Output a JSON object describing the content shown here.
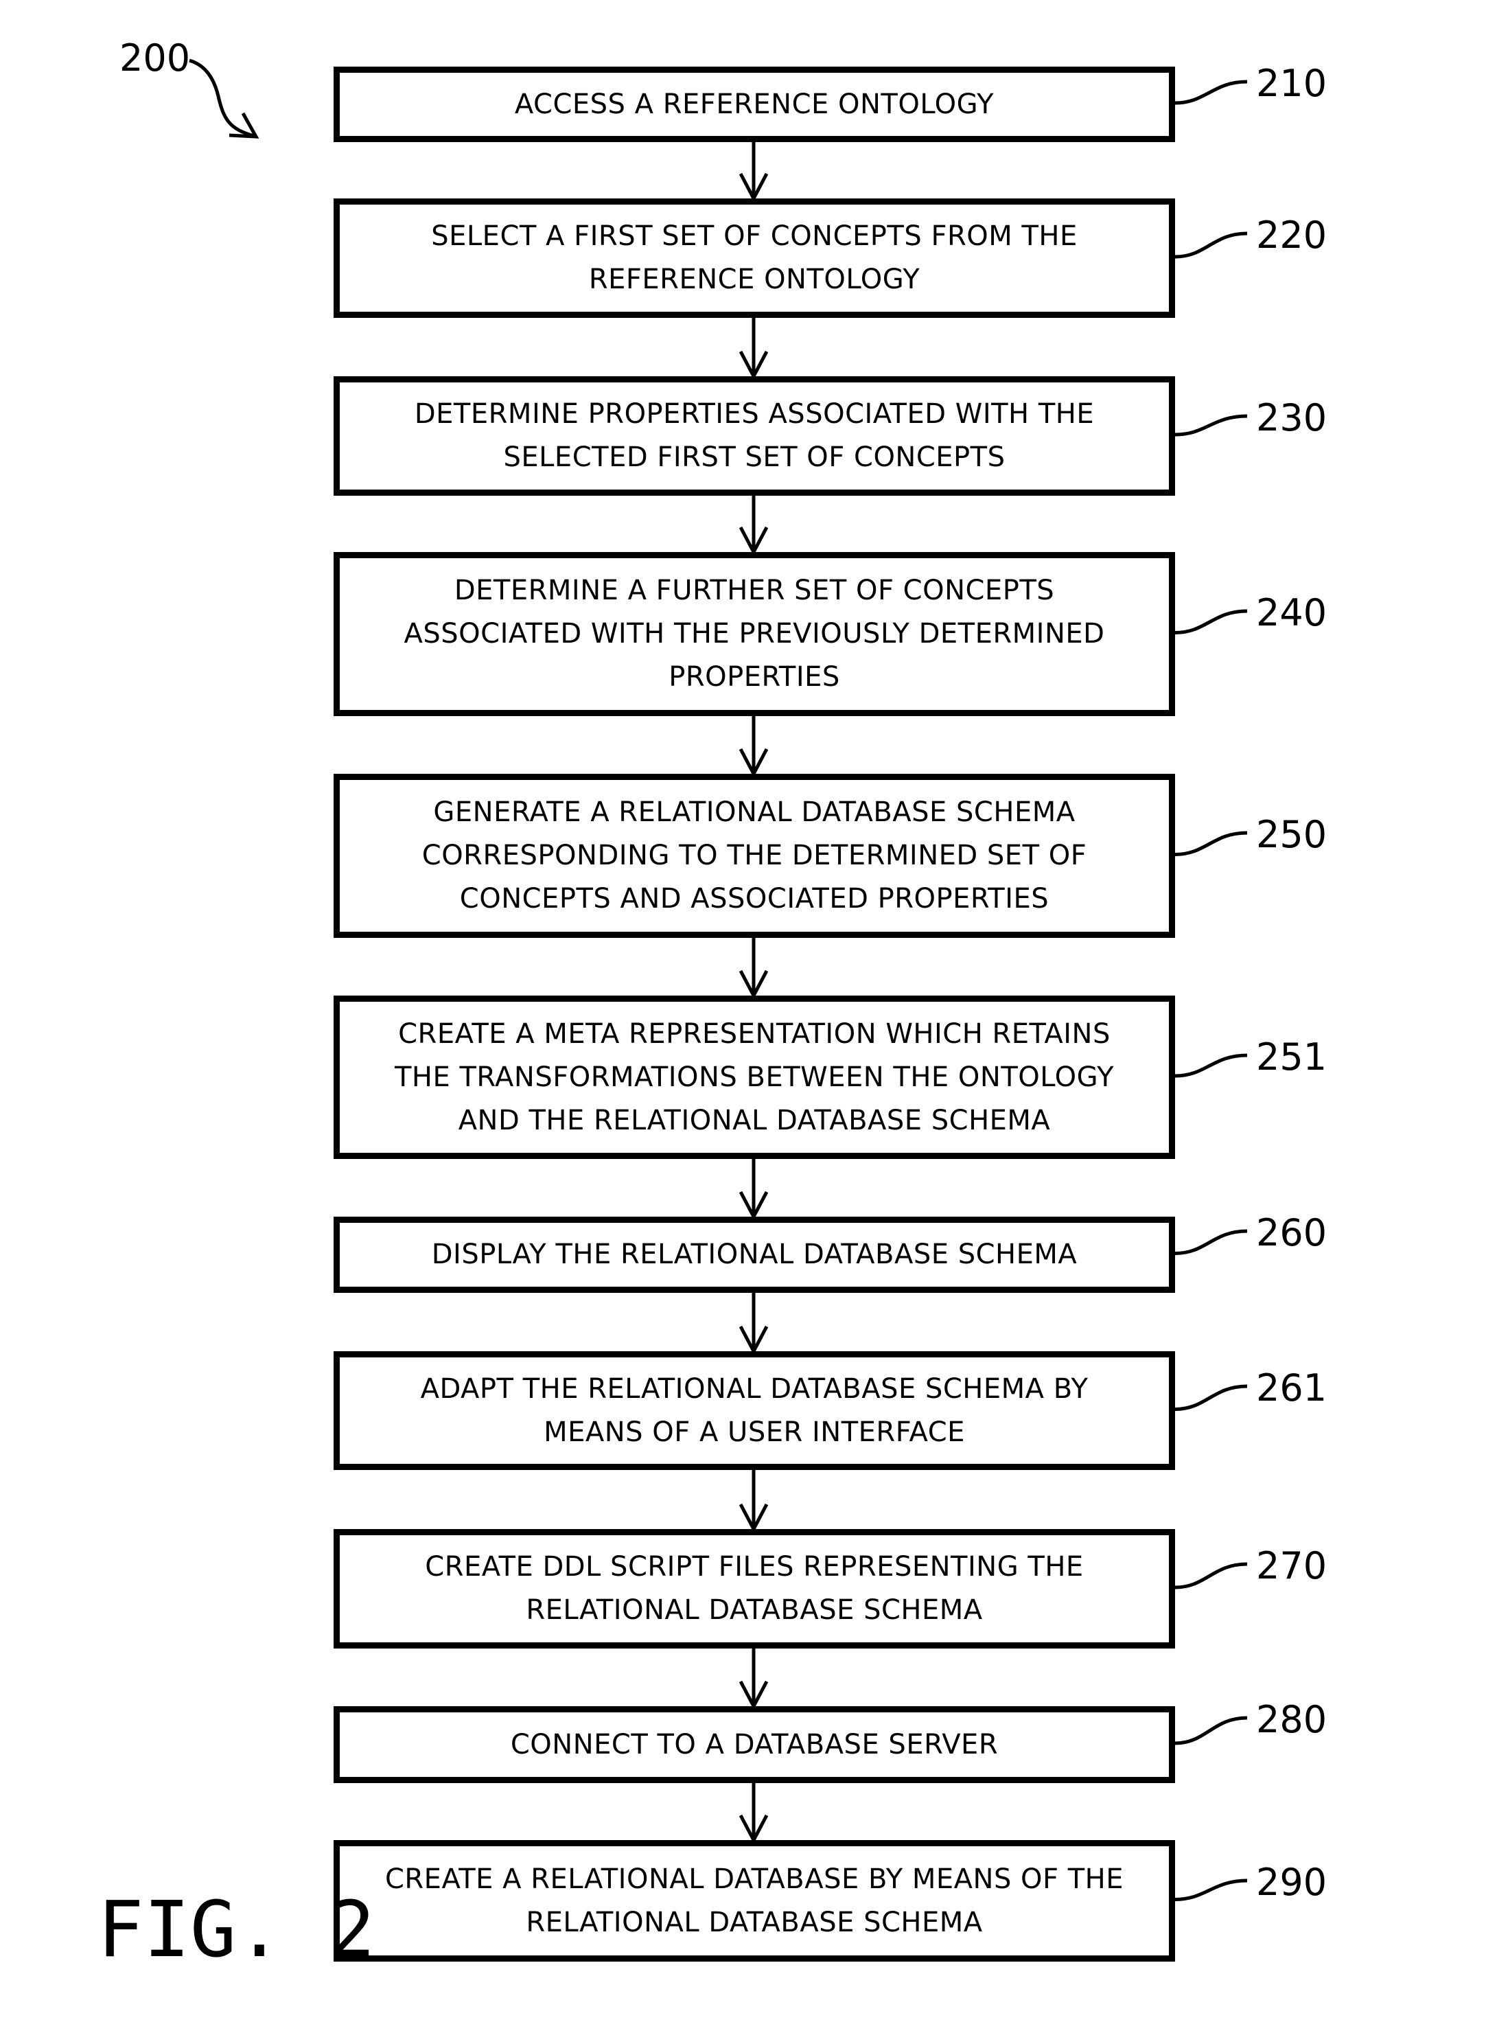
{
  "figure": {
    "title": "FIG. 2",
    "reference": "200",
    "steps": [
      {
        "ref": "210",
        "text": "ACCESS A REFERENCE ONTOLOGY"
      },
      {
        "ref": "220",
        "text": "SELECT A FIRST SET OF CONCEPTS FROM THE\nREFERENCE ONTOLOGY"
      },
      {
        "ref": "230",
        "text": "DETERMINE PROPERTIES ASSOCIATED WITH THE\nSELECTED FIRST SET OF CONCEPTS"
      },
      {
        "ref": "240",
        "text": "DETERMINE A FURTHER SET OF CONCEPTS\nASSOCIATED WITH THE PREVIOUSLY DETERMINED\nPROPERTIES"
      },
      {
        "ref": "250",
        "text": "GENERATE A RELATIONAL DATABASE SCHEMA\nCORRESPONDING TO THE DETERMINED SET OF\nCONCEPTS AND ASSOCIATED PROPERTIES"
      },
      {
        "ref": "251",
        "text": "CREATE A META REPRESENTATION WHICH RETAINS\nTHE TRANSFORMATIONS BETWEEN THE ONTOLOGY\nAND THE RELATIONAL DATABASE SCHEMA"
      },
      {
        "ref": "260",
        "text": "DISPLAY THE RELATIONAL DATABASE SCHEMA"
      },
      {
        "ref": "261",
        "text": "ADAPT THE RELATIONAL DATABASE SCHEMA BY\nMEANS OF A USER INTERFACE"
      },
      {
        "ref": "270",
        "text": "CREATE DDL SCRIPT FILES REPRESENTING THE\nRELATIONAL DATABASE SCHEMA"
      },
      {
        "ref": "280",
        "text": "CONNECT TO A DATABASE SERVER"
      },
      {
        "ref": "290",
        "text": "CREATE A RELATIONAL DATABASE BY MEANS OF THE\nRELATIONAL DATABASE SCHEMA"
      }
    ]
  }
}
